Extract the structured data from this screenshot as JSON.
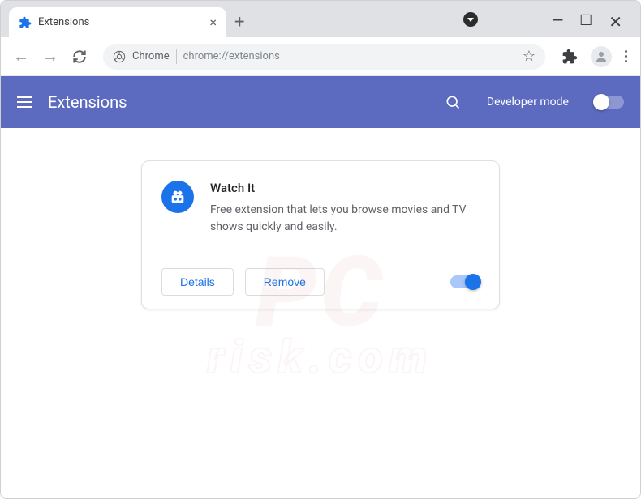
{
  "tab": {
    "title": "Extensions"
  },
  "omnibox": {
    "prefix": "Chrome",
    "url": "chrome://extensions"
  },
  "header": {
    "title": "Extensions",
    "dev_mode": "Developer mode"
  },
  "extension": {
    "name": "Watch It",
    "description": "Free extension that lets you browse movies and TV shows quickly and easily.",
    "details_label": "Details",
    "remove_label": "Remove",
    "enabled": true
  },
  "watermark": {
    "main": "PC",
    "sub": "risk.com"
  }
}
